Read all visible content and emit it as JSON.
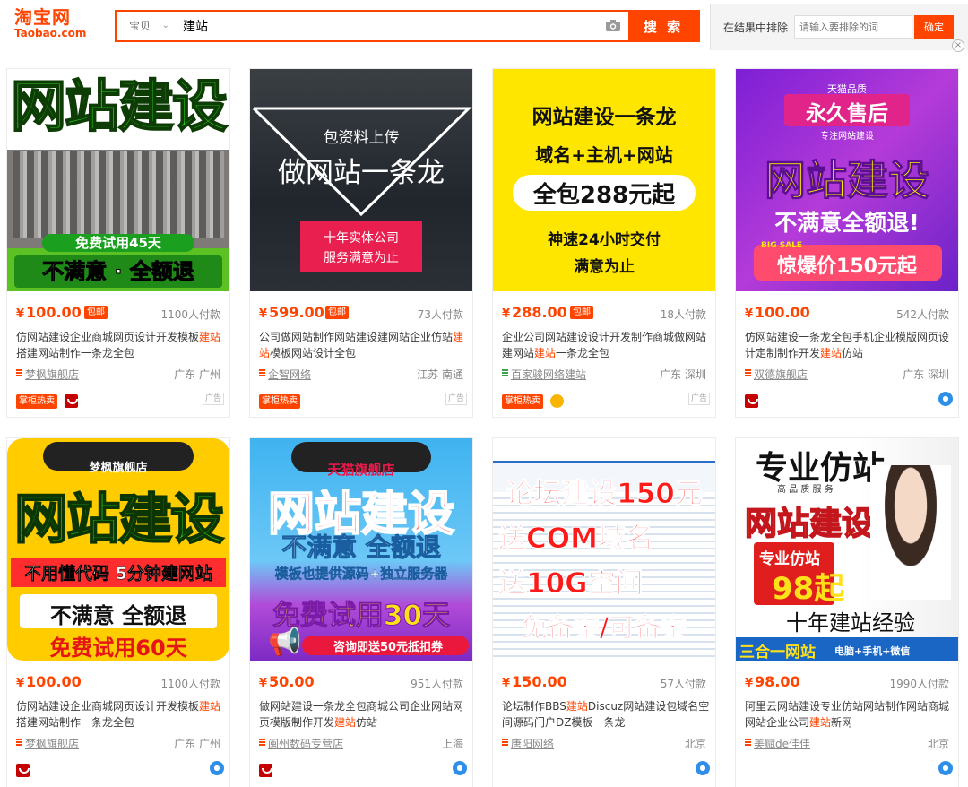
{
  "header": {
    "logo_cn": "淘宝网",
    "logo_en": "Taobao.com",
    "category": "宝贝",
    "query": "建站",
    "search_button": "搜 索",
    "exclude_label": "在结果中排除",
    "exclude_placeholder": "请输入要排除的词",
    "exclude_button": "确定",
    "close": "×"
  },
  "colors": {
    "accent": "#ff4400",
    "tmall_red": "#c40000",
    "wangwang_blue": "#2f8fe8"
  },
  "products": [
    {
      "image": {
        "line1": "网站建设",
        "line2": "免费试用45天",
        "line3": "不满意 · 全额退"
      },
      "price": "100.00",
      "free_shipping": "包邮",
      "sales": "1100人付款",
      "title_parts": [
        "仿网站建设企业商城网页设计开发模板",
        "建站",
        "搭建网站制作一条龙全包"
      ],
      "shop": "梦枫旗舰店",
      "location": "广东 广州",
      "hot_tag": "掌柜热卖",
      "badge": "tmall-icon",
      "ad": "广告"
    },
    {
      "image": {
        "line1": "包资料上传",
        "line2": "做网站一条龙",
        "line3": "十年实体公司",
        "line4": "服务满意为止"
      },
      "price": "599.00",
      "free_shipping": "包邮",
      "sales": "73人付款",
      "title_parts": [
        "公司做网站制作网站建设建网站企业仿站",
        "建站",
        "模板网站设计全包"
      ],
      "shop": "企智网络",
      "location": "江苏 南通",
      "hot_tag": "掌柜热卖",
      "badge": "",
      "ad": "广告"
    },
    {
      "image": {
        "line1": "网站建设一条龙",
        "line2": "域名+主机+网站",
        "line3": "全包288元起",
        "line4": "神速24小时交付",
        "line5": "满意为止"
      },
      "price": "288.00",
      "free_shipping": "包邮",
      "sales": "18人付款",
      "title_parts": [
        "企业公司网站建设设计开发制作商城做网站建网站",
        "建站",
        "一条龙全包"
      ],
      "shop": "百家骏网络建站",
      "location": "广东 深圳",
      "hot_tag": "掌柜热卖",
      "badge": "gold-icon",
      "ad": "广告"
    },
    {
      "image": {
        "line0": "天猫品质",
        "line1": "永久售后",
        "line1b": "专注网站建设",
        "line2": "网站建设",
        "line3": "不满意全额退!",
        "line4": "惊爆价150元起",
        "line4a": "BIG SALE"
      },
      "price": "100.00",
      "free_shipping": "",
      "sales": "542人付款",
      "title_parts": [
        "仿网站建设一条龙全包手机企业模版网页设计定制制作开发",
        "建站",
        "仿站"
      ],
      "shop": "双德旗舰店",
      "location": "广东 深圳",
      "hot_tag": "",
      "badge": "tmall-icon",
      "ad": ""
    },
    {
      "image": {
        "line0": "梦枫旗舰店",
        "line1": "网站建设",
        "line2": "不用懂代码 5分钟建网站",
        "line3": "不满意  全额退",
        "line4": "免费试用60天"
      },
      "price": "100.00",
      "free_shipping": "",
      "sales": "1100人付款",
      "title_parts": [
        "仿网站建设企业商城网页设计开发模板",
        "建站",
        "搭建网站制作一条龙全包"
      ],
      "shop": "梦枫旗舰店",
      "location": "广东 广州",
      "hot_tag": "",
      "badge": "tmall-icon",
      "ad": ""
    },
    {
      "image": {
        "line0": "天猫旗舰店",
        "line1": "网站建设",
        "line2": "不满意 全额退",
        "line3": "模板也提供源码+独立服务器",
        "line4": "免费试用30天",
        "line5": "咨询即送50元抵扣券"
      },
      "price": "50.00",
      "free_shipping": "",
      "sales": "951人付款",
      "title_parts": [
        "做网站建设一条龙全包商城公司企业网站网页模版制作开发",
        "建站",
        "仿站"
      ],
      "shop": "闽州数码专营店",
      "location": "上海",
      "hot_tag": "",
      "badge": "tmall-icon",
      "ad": ""
    },
    {
      "image": {
        "line1": "论坛建设150元",
        "line2": "送COM域名",
        "line3": "送10G空间",
        "line4": "免备案/可备案"
      },
      "price": "150.00",
      "free_shipping": "",
      "sales": "57人付款",
      "title_parts": [
        "论坛制作BBS",
        "建站",
        "Discuz网站建设包域名空间源码门户DZ模板一条龙"
      ],
      "shop": "唐阳网络",
      "location": "北京",
      "hot_tag": "",
      "badge": "",
      "ad": ""
    },
    {
      "image": {
        "line1": "专业仿站",
        "line1b": "高 品 质 服 务",
        "line2": "网站建设",
        "line3": "专业仿站",
        "line4": "98起",
        "line5": "十年建站经验",
        "line6": "三合一网站",
        "line6b": "电脑+手机+微信"
      },
      "price": "98.00",
      "free_shipping": "",
      "sales": "1990人付款",
      "title_parts": [
        "阿里云网站建设专业仿站网站制作网站商城网站企业公司",
        "建站",
        "新网"
      ],
      "shop": "美赋de佳佳",
      "location": "北京",
      "hot_tag": "",
      "badge": "",
      "ad": ""
    }
  ]
}
